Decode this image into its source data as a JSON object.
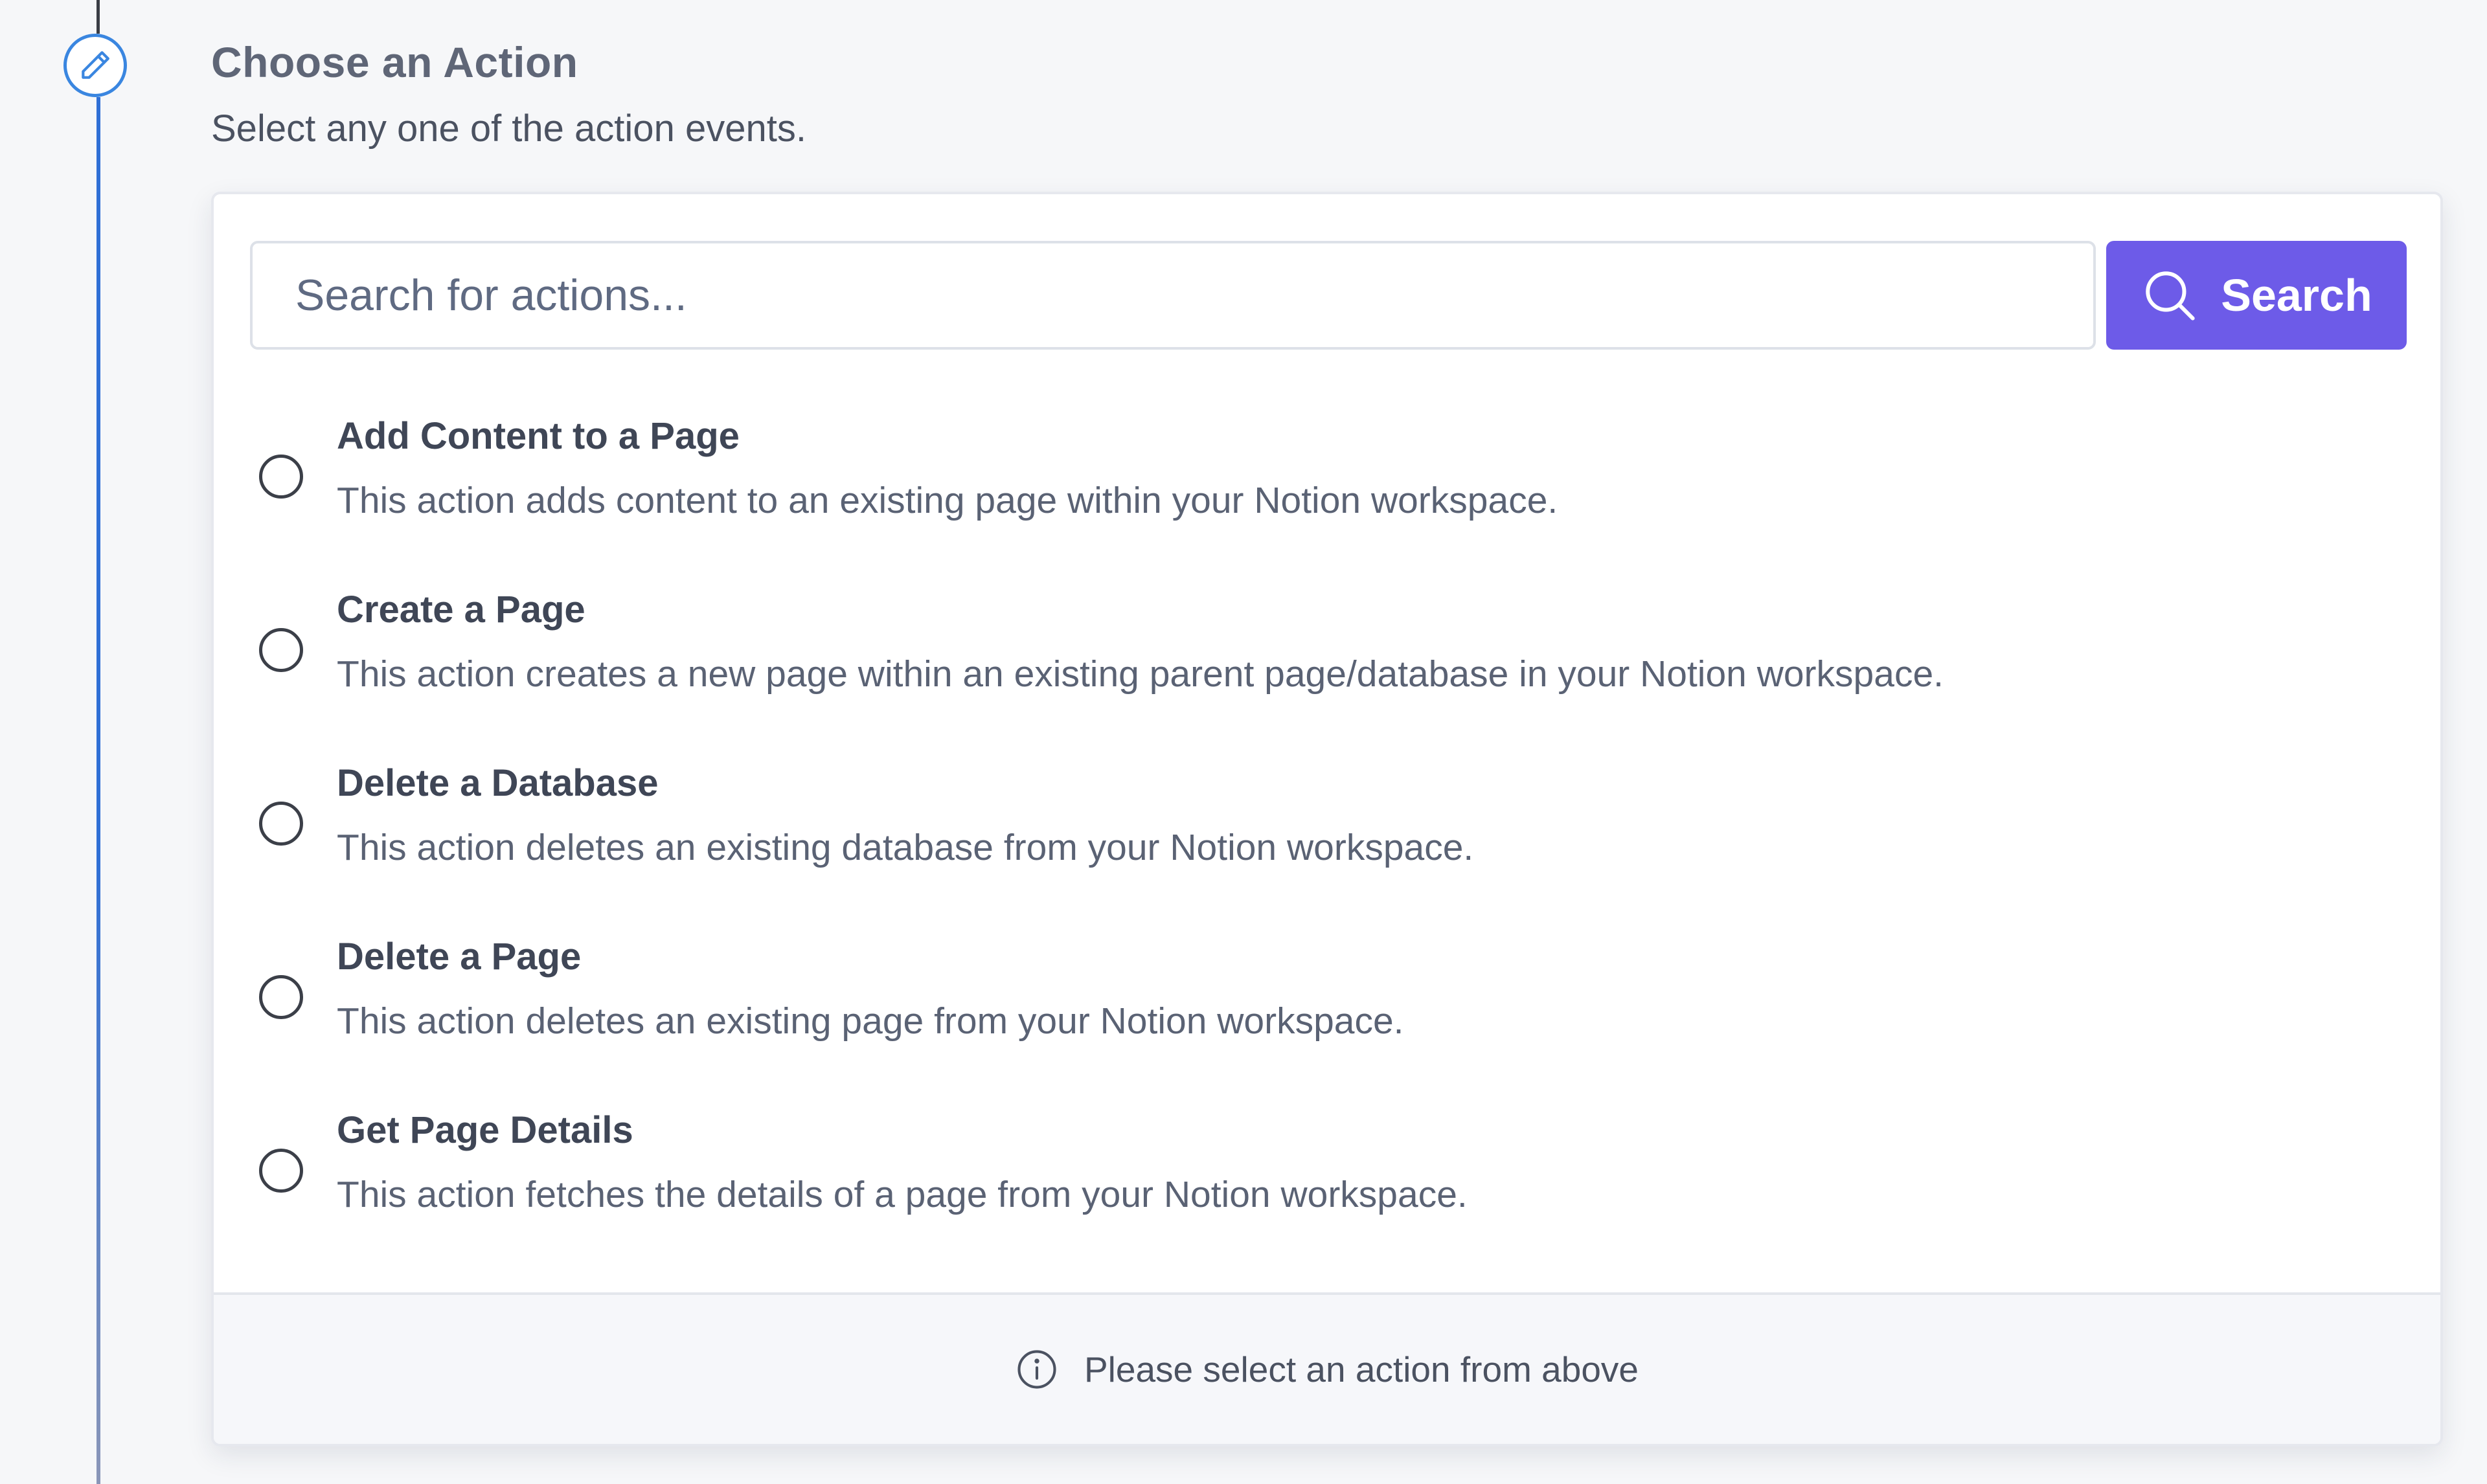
{
  "section": {
    "title": "Choose an Action",
    "subtitle": "Select any one of the action events."
  },
  "icons": {
    "step": "pencil-icon",
    "search": "search-icon",
    "info": "info-icon"
  },
  "search": {
    "placeholder": "Search for actions...",
    "button_label": "Search"
  },
  "actions": [
    {
      "title": "Add Content to a Page",
      "description": "This action adds content to an existing page within your Notion workspace."
    },
    {
      "title": "Create a Page",
      "description": "This action creates a new page within an existing parent page/database in your Notion workspace."
    },
    {
      "title": "Delete a Database",
      "description": "This action deletes an existing database from your Notion workspace."
    },
    {
      "title": "Delete a Page",
      "description": "This action deletes an existing page from your Notion workspace."
    },
    {
      "title": "Get Page Details",
      "description": "This action fetches the details of a page from your Notion workspace."
    }
  ],
  "footer": {
    "message": "Please select an action from above"
  },
  "colors": {
    "accent": "#6d5be8",
    "timeline": "#2f6fd6",
    "step_icon": "#3a86e0"
  }
}
